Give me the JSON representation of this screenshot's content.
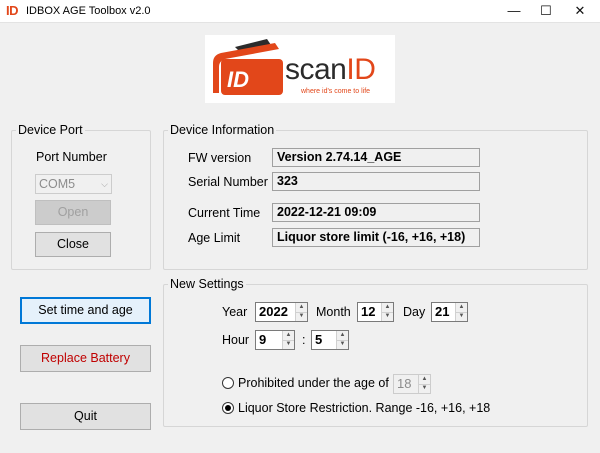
{
  "window": {
    "app_icon_text": "ID",
    "title": "IDBOX AGE Toolbox v2.0",
    "minimize_glyph": "—",
    "maximize_glyph": "☐",
    "close_glyph": "✕"
  },
  "logo": {
    "brand_text": "scanID",
    "tagline": "where id's come to life",
    "accent_color": "#e2471a",
    "dark_color": "#2b2b2b"
  },
  "device_port": {
    "title": "Device Port",
    "port_label": "Port Number",
    "port_value": "COM5",
    "open_label": "Open",
    "close_label": "Close"
  },
  "device_info": {
    "title": "Device Information",
    "fw_label": "FW version",
    "fw_value": "Version 2.74.14_AGE",
    "serial_label": "Serial Number",
    "serial_value": "323",
    "time_label": "Current Time",
    "time_value": "2022-12-21 09:09",
    "age_label": "Age Limit",
    "age_value": "Liquor store limit (-16, +16, +18)"
  },
  "actions": {
    "set_time_label": "Set time and age",
    "replace_battery_label": "Replace Battery",
    "quit_label": "Quit"
  },
  "new_settings": {
    "title": "New Settings",
    "year_label": "Year",
    "year_value": "2022",
    "month_label": "Month",
    "month_value": "12",
    "day_label": "Day",
    "day_value": "21",
    "hour_label": "Hour",
    "hour_value": "9",
    "time_separator": ":",
    "minute_value": "5",
    "prohibited_label": "Prohibited under the age of",
    "prohibited_age_value": "18",
    "liquor_label": "Liquor Store Restriction. Range -16, +16, +18",
    "selected_option": "liquor"
  }
}
